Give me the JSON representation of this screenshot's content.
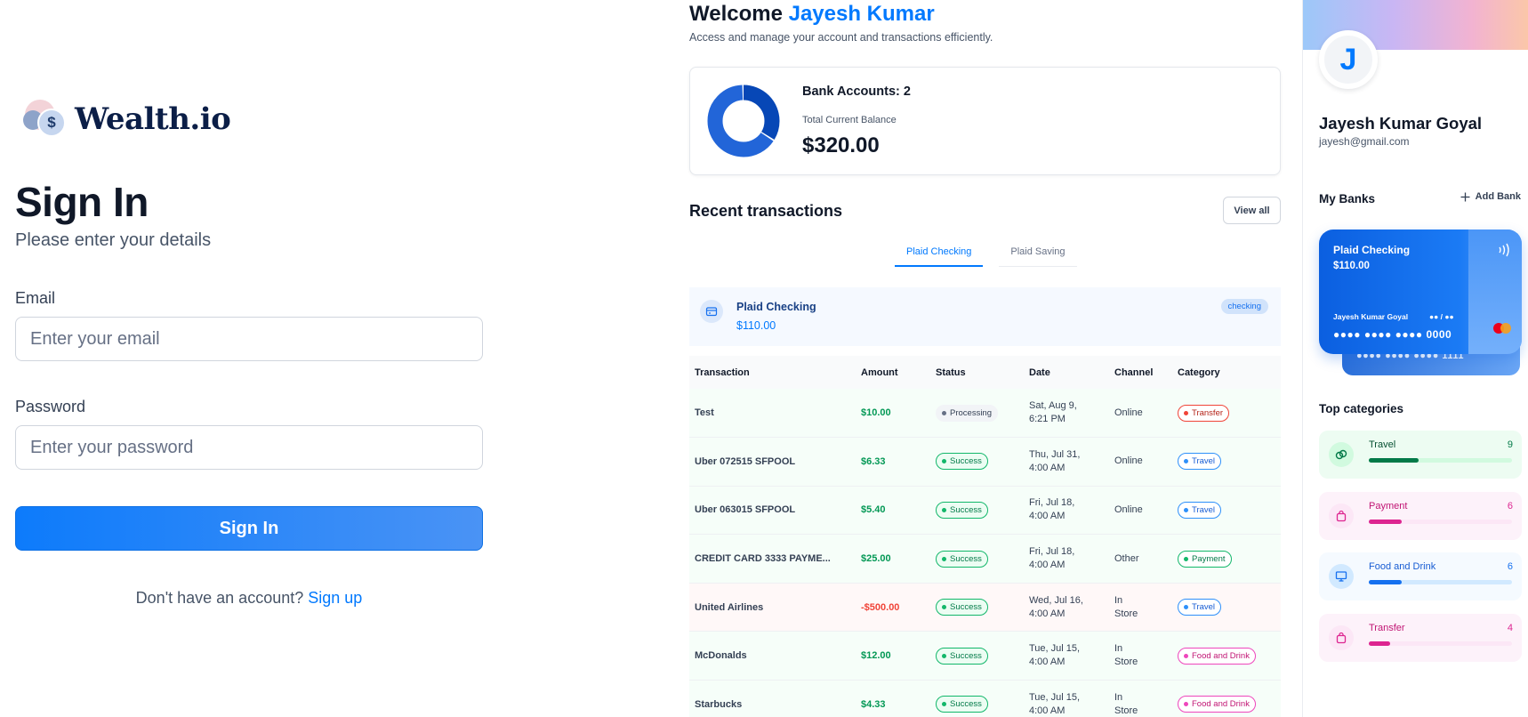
{
  "signin": {
    "logo_text": "Wealth.io",
    "logo_symbol": "$",
    "title": "Sign In",
    "subtitle": "Please enter your details",
    "email_label": "Email",
    "email_placeholder": "Enter your email",
    "email_value": "",
    "password_label": "Password",
    "password_placeholder": "Enter your password",
    "password_value": "",
    "submit_label": "Sign In",
    "footer_text": "Don't have an account?",
    "footer_link": "Sign up"
  },
  "home": {
    "welcome_prefix": "Welcome",
    "welcome_name": "Jayesh Kumar",
    "welcome_sub": "Access and manage your account and transactions efficiently.",
    "bank_accounts_label": "Bank Accounts: 2",
    "total_balance_label": "Total Current Balance",
    "total_balance": "$320.00",
    "donut_split": [
      110,
      210
    ],
    "donut_colors": [
      "#0747b6",
      "#2265d8"
    ],
    "recent_title": "Recent transactions",
    "view_all": "View all",
    "tabs": [
      {
        "label": "Plaid Checking",
        "active": true
      },
      {
        "label": "Plaid Saving",
        "active": false
      }
    ],
    "account": {
      "name": "Plaid Checking",
      "balance": "$110.00",
      "type": "checking"
    },
    "columns": [
      "Transaction",
      "Amount",
      "Status",
      "Date",
      "Channel",
      "Category"
    ],
    "transactions": [
      {
        "name": "Test",
        "amount": "$10.00",
        "sign": "pos",
        "status": "Processing",
        "date_l1": "Sat, Aug 9,",
        "date_l2": "6:21 PM",
        "channel_l1": "Online",
        "channel_l2": "",
        "category": "Transfer"
      },
      {
        "name": "Uber 072515 SFPOOL",
        "amount": "$6.33",
        "sign": "pos",
        "status": "Success",
        "date_l1": "Thu, Jul 31,",
        "date_l2": "4:00 AM",
        "channel_l1": "Online",
        "channel_l2": "",
        "category": "Travel"
      },
      {
        "name": "Uber 063015 SFPOOL",
        "amount": "$5.40",
        "sign": "pos",
        "status": "Success",
        "date_l1": "Fri, Jul 18,",
        "date_l2": "4:00 AM",
        "channel_l1": "Online",
        "channel_l2": "",
        "category": "Travel"
      },
      {
        "name": "CREDIT CARD 3333 PAYME...",
        "amount": "$25.00",
        "sign": "pos",
        "status": "Success",
        "date_l1": "Fri, Jul 18,",
        "date_l2": "4:00 AM",
        "channel_l1": "Other",
        "channel_l2": "",
        "category": "Payment"
      },
      {
        "name": "United Airlines",
        "amount": "-$500.00",
        "sign": "neg",
        "status": "Success",
        "date_l1": "Wed, Jul 16,",
        "date_l2": "4:00 AM",
        "channel_l1": "In",
        "channel_l2": "Store",
        "category": "Travel"
      },
      {
        "name": "McDonalds",
        "amount": "$12.00",
        "sign": "pos",
        "status": "Success",
        "date_l1": "Tue, Jul 15,",
        "date_l2": "4:00 AM",
        "channel_l1": "In",
        "channel_l2": "Store",
        "category": "Food and Drink"
      },
      {
        "name": "Starbucks",
        "amount": "$4.33",
        "sign": "pos",
        "status": "Success",
        "date_l1": "Tue, Jul 15,",
        "date_l2": "4:00 AM",
        "channel_l1": "In",
        "channel_l2": "Store",
        "category": "Food and Drink"
      }
    ]
  },
  "sidebar": {
    "avatar_initial": "J",
    "name": "Jayesh Kumar Goyal",
    "email": "jayesh@gmail.com",
    "my_banks_title": "My Banks",
    "add_bank_label": "Add Bank",
    "card": {
      "name": "Plaid Checking",
      "balance": "$110.00",
      "holder": "Jayesh Kumar Goyal",
      "expiry": "●● / ●●",
      "number": "●●●● ●●●● ●●●● 0000",
      "back_number": "●●●● ●●●● ●●●● 1111"
    },
    "top_categories_title": "Top categories",
    "categories": [
      {
        "name": "Travel",
        "count": "9",
        "progress": 0.35,
        "icon": "link-icon",
        "bg": "#edfcf2",
        "icon_bg": "#d1fadf",
        "text": "#054f31",
        "track": "#d1fadf",
        "fill": "#027a48"
      },
      {
        "name": "Payment",
        "count": "6",
        "progress": 0.23,
        "icon": "bag-icon",
        "bg": "#fdf2fa",
        "icon_bg": "#fce7f6",
        "text": "#c11574",
        "track": "#fce7f6",
        "fill": "#dd2590"
      },
      {
        "name": "Food and Drink",
        "count": "6",
        "progress": 0.23,
        "icon": "monitor-icon",
        "bg": "#f5faff",
        "icon_bg": "#d1e9ff",
        "text": "#175cd3",
        "track": "#d1e9ff",
        "fill": "#1570ef"
      },
      {
        "name": "Transfer",
        "count": "4",
        "progress": 0.15,
        "icon": "bag-icon",
        "bg": "#fdf2fa",
        "icon_bg": "#fce7f6",
        "text": "#c11574",
        "track": "#fce7f6",
        "fill": "#dd2590"
      }
    ]
  }
}
